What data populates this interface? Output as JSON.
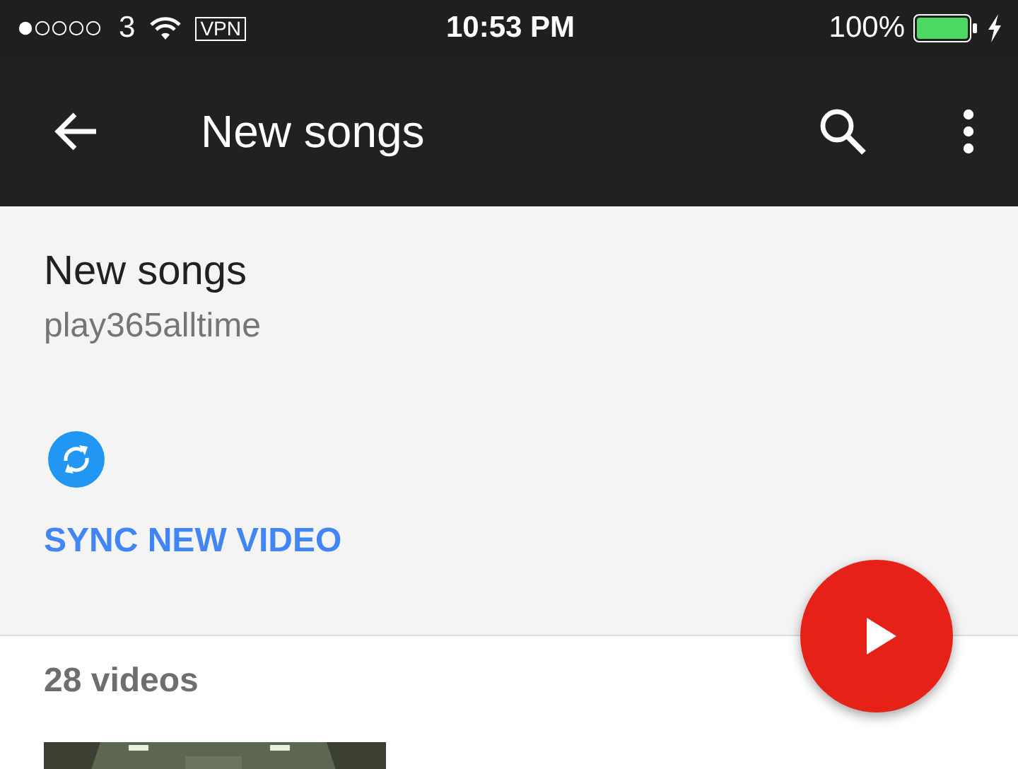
{
  "status_bar": {
    "carrier": "3",
    "vpn": "VPN",
    "time": "10:53 PM",
    "battery": "100%"
  },
  "toolbar": {
    "title": "New songs"
  },
  "header": {
    "title": "New songs",
    "owner": "play365alltime",
    "sync_label": "SYNC NEW VIDEO"
  },
  "video_count": "28 videos"
}
